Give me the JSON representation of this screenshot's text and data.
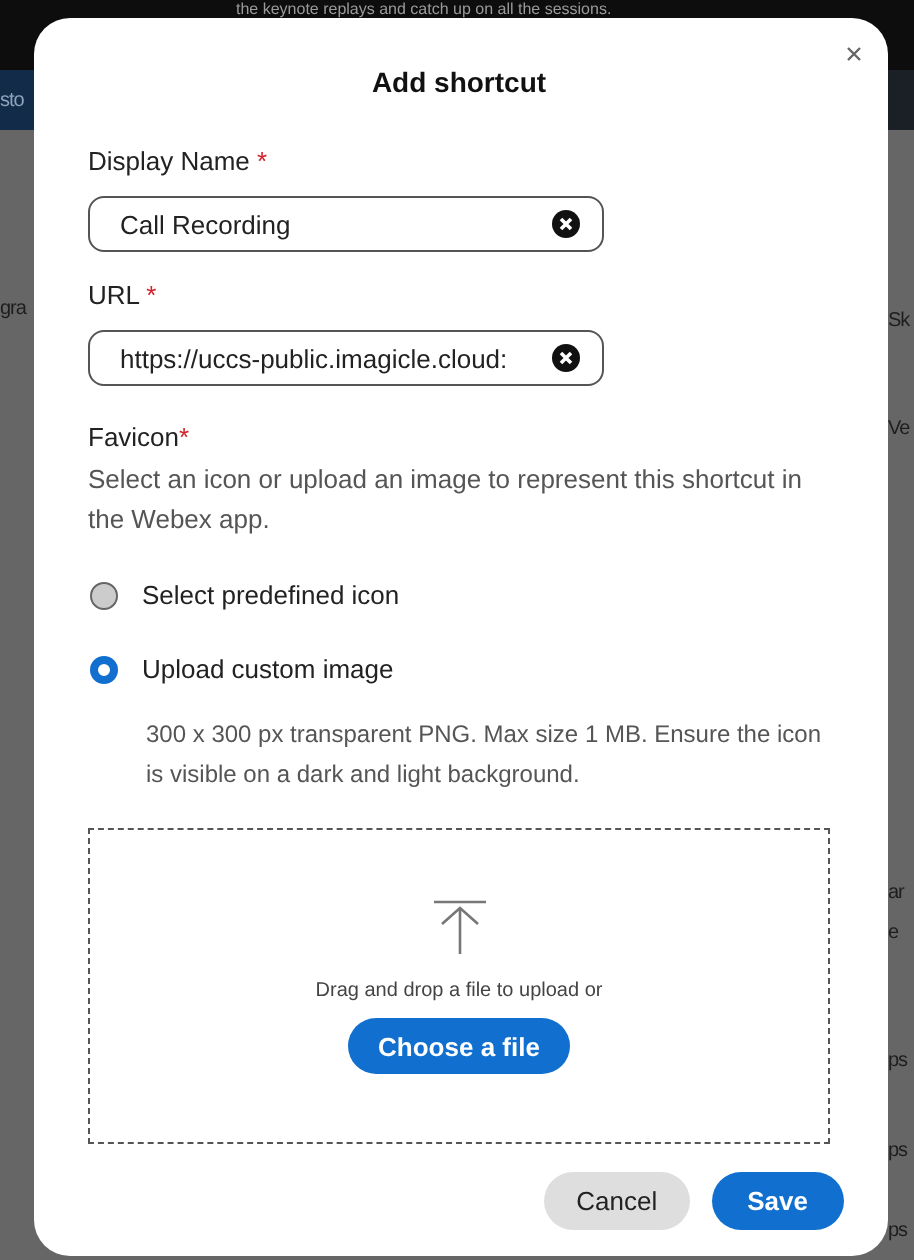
{
  "backdrop": {
    "banner_text": "the keynote replays and catch up on all the sessions.",
    "nav_tab": "sto",
    "left_fragments": [
      "gra"
    ],
    "right_fragments": [
      "Sk",
      "Ve",
      "ar",
      "e",
      "ps",
      "ps",
      "ps"
    ]
  },
  "dialog": {
    "title": "Add shortcut",
    "fields": [
      {
        "label": "Display Name",
        "required_mark": "*",
        "value": "Call Recording"
      },
      {
        "label": "URL",
        "required_mark": "*",
        "value": "https://uccs-public.imagicle.cloud:"
      }
    ],
    "favicon": {
      "label": "Favicon",
      "required_mark": "*",
      "description": "Select an icon or upload an image to represent this shortcut in the Webex app."
    },
    "options": [
      {
        "label": "Select predefined icon",
        "selected": false
      },
      {
        "label": "Upload custom image",
        "selected": true,
        "note": "300 x 300 px transparent PNG. Max size 1 MB. Ensure the icon is visible on a dark and light background."
      }
    ],
    "dropzone": {
      "text": "Drag and drop a file to upload or",
      "button": "Choose a file"
    },
    "buttons": [
      {
        "label": "Cancel",
        "kind": "secondary"
      },
      {
        "label": "Save",
        "kind": "primary"
      }
    ]
  }
}
